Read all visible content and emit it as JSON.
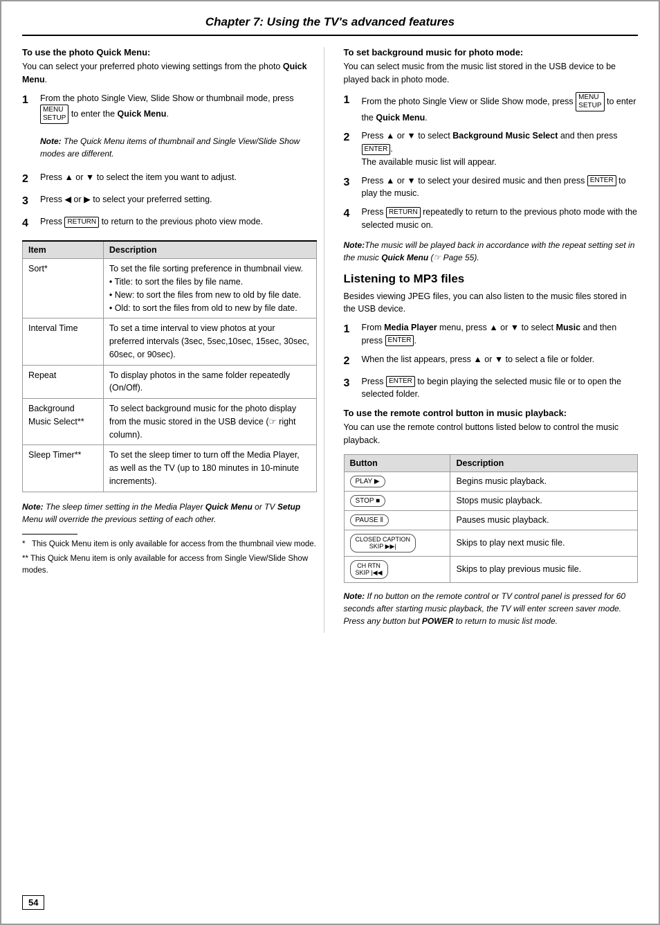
{
  "page": {
    "chapter_title": "Chapter 7: Using the TV's advanced features",
    "page_number": "54"
  },
  "left_section": {
    "heading": "To use the photo Quick Menu:",
    "intro": "You can select your preferred photo viewing settings from the photo Quick Menu.",
    "steps": [
      {
        "num": "1",
        "text": "From the photo Single View, Slide Show or thumbnail mode, press",
        "icon": "MENU/SETUP",
        "text2": "to enter the",
        "bold": "Quick Menu",
        "text3": "."
      },
      {
        "num": "",
        "note_label": "Note:",
        "note_text": "The Quick Menu items of thumbnail and Single View/Slide Show modes are different."
      },
      {
        "num": "2",
        "text": "Press ▲ or ▼ to select the item you want to adjust."
      },
      {
        "num": "3",
        "text": "Press ◀ or ▶ to select your preferred setting."
      },
      {
        "num": "4",
        "text": "Press",
        "icon": "RETURN",
        "text2": "to return to the previous photo view mode."
      }
    ],
    "table": {
      "headers": [
        "Item",
        "Description"
      ],
      "rows": [
        {
          "item": "Sort*",
          "desc": "To set the file sorting preference in thumbnail view.\n• Title: to sort the files by file name.\n• New: to sort the files from new to old by file date.\n• Old: to sort the files from old to new by file date."
        },
        {
          "item": "Interval Time",
          "desc": "To set a time interval to view photos at your preferred intervals (3sec, 5sec,10sec, 15sec, 30sec, 60sec, or 90sec)."
        },
        {
          "item": "Repeat",
          "desc": "To display photos in the same folder repeatedly (On/Off)."
        },
        {
          "item": "Background Music Select**",
          "desc": "To select background music for the photo display from the music stored in the USB device (☞ right column)."
        },
        {
          "item": "Sleep Timer**",
          "desc": "To set the sleep timer to turn off the Media Player, as well as the TV (up to 180 minutes in 10-minute increments)."
        }
      ]
    },
    "bottom_note": "Note: The sleep timer setting in the Media Player Quick Menu or TV Setup Menu will override the previous setting of each other.",
    "footnotes": [
      "*   This Quick Menu item is only available for access from the thumbnail view mode.",
      "**  This Quick Menu item is only available for access from Single View/Slide Show modes."
    ]
  },
  "right_section": {
    "bg_music_heading": "To set background music for photo mode:",
    "bg_music_intro": "You can select music from the music list stored in the USB device to be played back in photo mode.",
    "bg_steps": [
      {
        "num": "1",
        "text": "From the photo Single View or Slide Show mode, press",
        "icon": "MENU/SETUP",
        "text2": "to enter the",
        "bold": "Quick Menu",
        "text3": "."
      },
      {
        "num": "2",
        "text": "Press ▲ or ▼ to select",
        "bold": "Background Music Select",
        "text2": "and then press",
        "icon": "ENTER",
        "text3": ".\nThe available music list will appear."
      },
      {
        "num": "3",
        "text": "Press ▲ or ▼ to select your desired music and then press",
        "icon": "ENTER",
        "text2": "to play the music."
      },
      {
        "num": "4",
        "text": "Press",
        "icon": "RETURN",
        "text2": "repeatedly to return to the previous photo mode with the selected music on."
      }
    ],
    "bg_note": "Note:The music will be played back in accordance with the repeat setting set in the music Quick Menu (☞ Page 55).",
    "mp3_title": "Listening to MP3 files",
    "mp3_intro": "Besides viewing JPEG files, you can also listen to the music files stored in the USB device.",
    "mp3_steps": [
      {
        "num": "1",
        "text": "From",
        "bold": "Media Player",
        "text2": "menu, press ▲ or ▼ to select",
        "bold2": "Music",
        "text3": "and then press",
        "icon": "ENTER",
        "text4": "."
      },
      {
        "num": "2",
        "text": "When the list appears, press ▲ or ▼ to select a file or folder."
      },
      {
        "num": "3",
        "text": "Press",
        "icon": "ENTER",
        "text2": "to begin playing the selected music file or to open the selected folder."
      }
    ],
    "remote_heading": "To use the remote control button in music playback:",
    "remote_intro": "You can use the remote control buttons listed below to control the music playback.",
    "button_table": {
      "headers": [
        "Button",
        "Description"
      ],
      "rows": [
        {
          "button": "PLAY ▶",
          "desc": "Begins music playback."
        },
        {
          "button": "STOP ■",
          "desc": "Stops music playback."
        },
        {
          "button": "PAUSE ‖",
          "desc": "Pauses music playback."
        },
        {
          "button": "CLOSED CAPTION SKIP ▶▶|",
          "desc": "Skips to play next music file."
        },
        {
          "button": "CH RTN SKIP |◀◀",
          "desc": "Skips to play previous music file."
        }
      ]
    },
    "bottom_note": "Note: If no button on the remote control or TV control panel is pressed for 60 seconds after starting music playback, the TV will enter screen saver mode. Press any button but POWER to return to music list mode."
  }
}
